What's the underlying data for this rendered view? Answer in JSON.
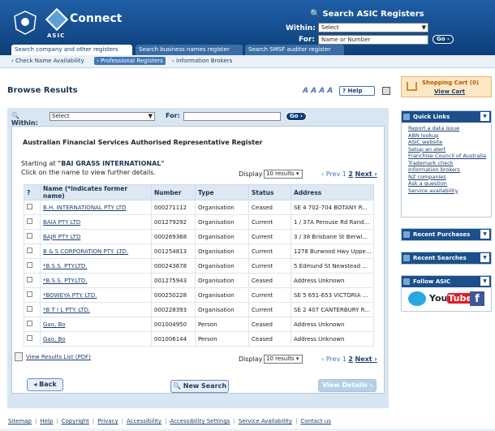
{
  "header": {
    "brand": "Connect",
    "asic": "ASIC",
    "search_title": "Search ASIC Registers",
    "within_label": "Within:",
    "within_value": "Select",
    "for_label": "For:",
    "for_placeholder": "Name or Number",
    "go": "Go"
  },
  "tabs": [
    "Search company and other registers",
    "Search business names register",
    "Search SMSF auditor register"
  ],
  "subnav": [
    "Check Name Availability",
    "Professional Registers",
    "Information Brokers"
  ],
  "page": {
    "title": "Browse Results",
    "text_size": "A A A A",
    "help": "Help",
    "cart_title": "Shopping Cart (0)",
    "view_cart": "View Cart"
  },
  "search": {
    "within_label": "Within:",
    "within_value": "Select",
    "for_label": "For:",
    "go": "Go"
  },
  "results": {
    "register_title": "Australian Financial Services Authorised Representative Register",
    "starting_prefix": "Starting at",
    "starting_value": "\"BAI GRASS INTERNATIONAL\"",
    "click_hint": "Click on the name to view further details.",
    "display_label": "Display",
    "display_value": "10 results",
    "prev": "Prev",
    "page1": "1",
    "page2": "2",
    "next": "Next",
    "columns": [
      "?",
      "Name (*indicates former name)",
      "Number",
      "Type",
      "Status",
      "Address"
    ],
    "rows": [
      [
        "B.H. INTERNATIONAL PTY LTD",
        "000271112",
        "Organisation",
        "Ceased",
        "SE 4 702-704 BOTANY R..."
      ],
      [
        "BAIA PTY LTD",
        "001279292",
        "Organisation",
        "Current",
        "1 / 37A Perouse Rd Rand..."
      ],
      [
        "BAJR PTY LTD",
        "000269368",
        "Organisation",
        "Current",
        "3 / 38 Brisbane St Berwi..."
      ],
      [
        "B & S CORPORATION PTY. LTD.",
        "001254813",
        "Organisation",
        "Current",
        "1278 Burwood Hwy Uppe..."
      ],
      [
        "*B.S.S. PTY.LTD.",
        "000243678",
        "Organisation",
        "Current",
        "5 Edmund St Newstead ..."
      ],
      [
        "*B.S.S. PTY.LTD.",
        "001275943",
        "Organisation",
        "Ceased",
        "Address Unknown"
      ],
      [
        "*BOWEYA PTY. LTD.",
        "000250228",
        "Organisation",
        "Current",
        "SE 5 651-653 VICTORIA ..."
      ],
      [
        "*B T I L PTY. LTD.",
        "000228393",
        "Organisation",
        "Current",
        "SE 2 407 CANTERBURY R..."
      ],
      [
        "Gao, Bo",
        "001004950",
        "Person",
        "Ceased",
        "Address Unknown"
      ],
      [
        "Gao, Bo",
        "001006144",
        "Person",
        "Ceased",
        "Address Unknown"
      ]
    ],
    "pdf": "View Results List (PDF)",
    "back": "Back",
    "new_search": "New Search",
    "view_details": "View Details"
  },
  "sidebar": {
    "quick_links_title": "Quick Links",
    "quick_links": [
      "Report a data issue",
      "ABN lookup",
      "ASIC website",
      "Setup an alert",
      "Franchise Council of Australia",
      "Trademark check",
      "Information brokers",
      "NZ companies",
      "Ask a question",
      "Service availability"
    ],
    "recent_purchases": "Recent Purchases",
    "recent_searches": "Recent Searches",
    "follow": "Follow ASIC"
  },
  "footer": [
    "Sitemap",
    "Help",
    "Copyright",
    "Privacy",
    "Accessibility",
    "Accessibility Settings",
    "Service Availability",
    "Contact us"
  ]
}
